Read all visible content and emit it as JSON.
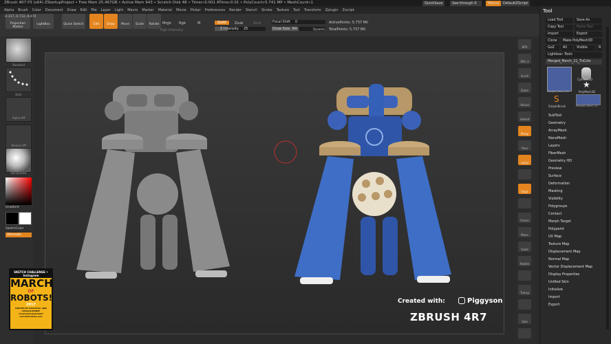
{
  "titlebar": {
    "text": "ZBrush 4R7 P3 (x64)   ZStartupProject   • Free Mem 25.467GB • Active Mem 943 • Scratch Disk 48 • Timer»0.001 ATime»0.01 • PolyCount»5.741 MP • MeshCount»1",
    "quicksave": "QuickSave",
    "seethrough": "See-through",
    "seethrough_value": "0",
    "menus": "Menus",
    "script": "DefaultZScript"
  },
  "menubar": [
    "Alpha",
    "Brush",
    "Color",
    "Document",
    "Draw",
    "Edit",
    "File",
    "Layer",
    "Light",
    "Macro",
    "Marker",
    "Material",
    "Movie",
    "Picker",
    "Preferences",
    "Render",
    "Stencil",
    "Stroke",
    "Texture",
    "Tool",
    "Transform",
    "Zplugin",
    "Zscript"
  ],
  "toolbar": {
    "projection": "Projection",
    "master": "Master",
    "lightbox": "LightBox",
    "quicksketch": "Quick Sketch",
    "edit": "Edit",
    "draw": "Draw",
    "move": "Move",
    "scale": "Scale",
    "rotate": "Rotate",
    "mrgb": "Mrgb",
    "rgb": "Rgb",
    "m": "M",
    "zadd": "Zadd",
    "zsub": "Zsub",
    "zcut": "Zcut",
    "rgb_intensity": "Rgb Intensity",
    "z_intensity": "Z Intensity",
    "z_intensity_value": "25",
    "z_intensity_level": 0.25,
    "focal_shift": "Focal Shift",
    "focal_shift_value": "0",
    "draw_size": "Draw Size",
    "draw_size_value": "64",
    "draw_size_level": 0.5,
    "dynamic": "Dynamic",
    "active_points": "ActivePoints: 5.737 Mil",
    "total_points": "TotalPoints: 5.737 Mil"
  },
  "coords": "-0.317,-0.712,-0.474",
  "leftshelf": {
    "brush": "Standard",
    "stroke": "Dots",
    "alpha": "Alpha Off",
    "texture": "Texture Off",
    "material": "SkinShade4",
    "gradient": "Gradient",
    "switchcolor": "SwitchColor",
    "alternate": "Alternate"
  },
  "rightshelf": [
    "BPR",
    "SPix 3",
    "Scroll",
    "Zoom",
    "Actual",
    "AAHalf",
    "Persp",
    "Floor",
    "Local",
    "",
    "Gxyz",
    "",
    "Frame",
    "Move",
    "Scale",
    "Rotate",
    "",
    "Transp",
    "",
    "Solo",
    ""
  ],
  "toolpanel": {
    "title": "Tool",
    "load": "Load Tool",
    "saveas": "Save As",
    "copy": "Copy Tool",
    "paste": "Paste Tool",
    "import": "Import",
    "export": "Export",
    "clone": "Clone",
    "makepoly": "Make PolyMesh3D",
    "goz": "GoZ",
    "all": "All",
    "visible": "Visible",
    "r": "R",
    "lightbox_tools": "Lightbox› Tools",
    "current_tool": "Merged_March_21_TnColo",
    "tools": [
      "Merged_March_21",
      "Cylinder3D",
      "PolyMesh3D",
      "SimpleBrush",
      "Merged_March_21"
    ],
    "subpalettes": [
      "SubTool",
      "Geometry",
      "ArrayMesh",
      "NanoMesh",
      "Layers",
      "FiberMesh",
      "Geometry HD",
      "Preview",
      "Surface",
      "Deformation",
      "Masking",
      "Visibility",
      "Polygroups",
      "Contact",
      "Morph Target",
      "Polypaint",
      "UV Map",
      "Texture Map",
      "Displacement Map",
      "Normal Map",
      "Vector Displacement Map",
      "Display Properties",
      "Unified Skin",
      "Initialize",
      "Import",
      "Export"
    ]
  },
  "canvas_text": {
    "created": "Created with:",
    "instagram": "Piggyson",
    "zbrush": "ZBRUSH 4R7"
  },
  "logo": {
    "top": "SKETCH CHALLENGE • Instagram",
    "march": "MARCH",
    "of": "OF",
    "robots": "ROBOTS!",
    "year": "2017",
    "hosted": "HOSTED BY DACOSTA! AND CHOCOLATEDEF",
    "tags": "#marchofrobots2017  marchofrobots.com"
  },
  "colors": {
    "accent": "#e3841f",
    "robot_blue": "#3b62b8",
    "robot_tan": "#b89868"
  }
}
